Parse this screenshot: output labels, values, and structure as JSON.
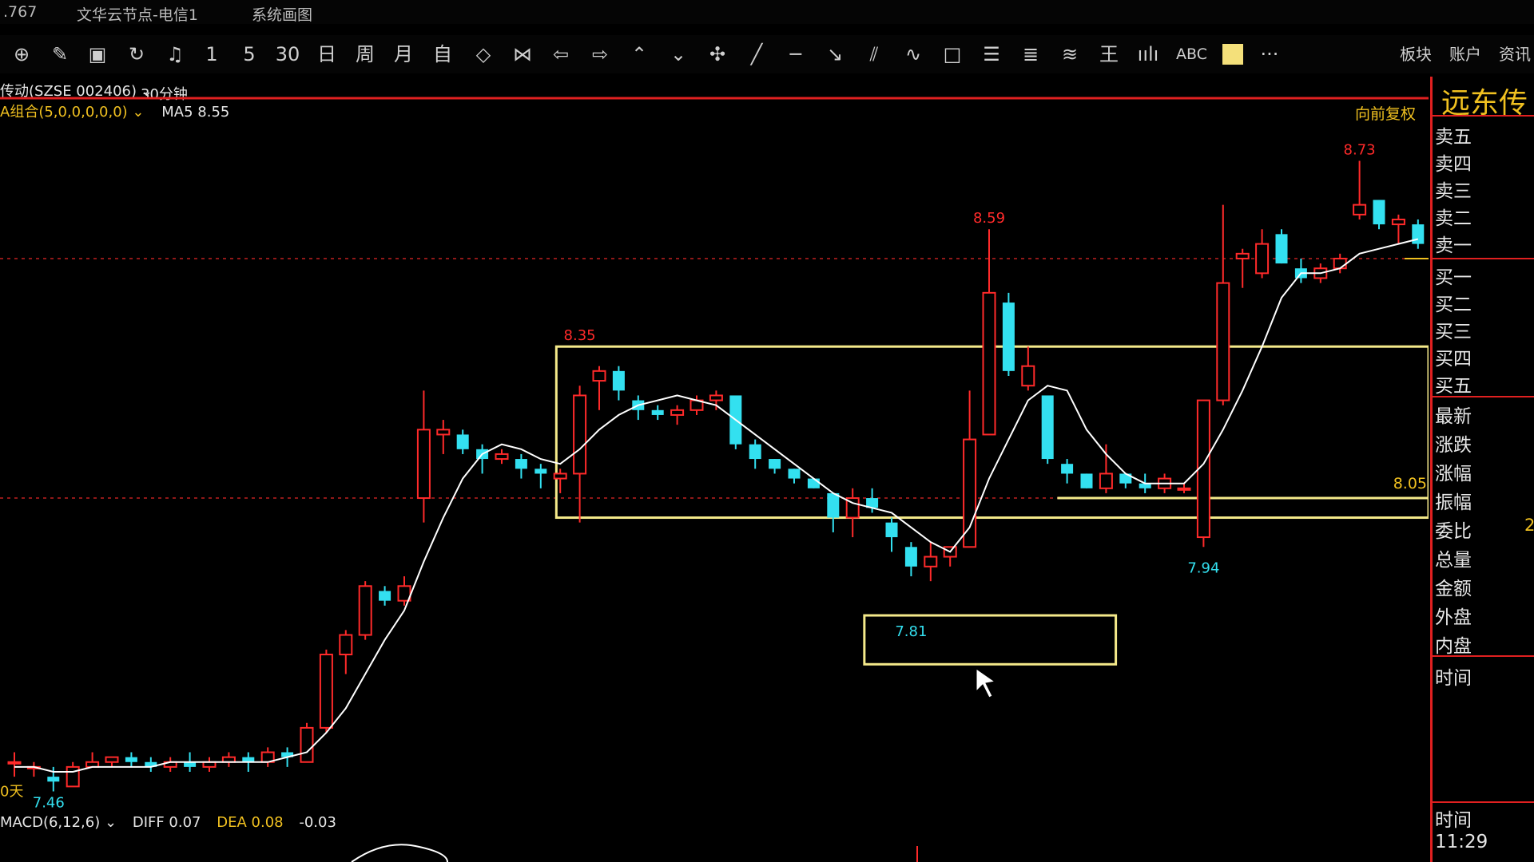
{
  "titlebar": {
    "left_num": ".767",
    "server": "文华云节点-电信1",
    "menu": "系统画图"
  },
  "toolbar": {
    "periods": [
      "1",
      "5",
      "30",
      "日",
      "周",
      "月",
      "自"
    ],
    "text_button": "ABC",
    "more": "···",
    "right_items": [
      "板块",
      "账户",
      "资讯"
    ]
  },
  "chart_header": {
    "stock": "传动(SZSE 002406)",
    "period_select": "30分钟",
    "ma_combo": "A组合(5,0,0,0,0,0)",
    "ma5_label": "MA5",
    "ma5_value": "8.55",
    "adjust": "向前复权"
  },
  "right_panel": {
    "name": "远东传",
    "labels": [
      "卖五",
      "卖四",
      "卖三",
      "卖二",
      "卖一",
      "买一",
      "买二",
      "买三",
      "买四",
      "买五",
      "最新",
      "涨跌",
      "涨幅",
      "振幅",
      "委比",
      "总量",
      "金额",
      "外盘",
      "内盘"
    ],
    "weibi_partial": "2",
    "time_label": "时间",
    "time_label2": "时间",
    "time_value": "11:29"
  },
  "macd": {
    "label": "MACD(6,12,6)",
    "diff": "DIFF 0.07",
    "dea": "DEA 0.08",
    "macd_value": "-0.03"
  },
  "colors": {
    "up": "#ff2a2a",
    "down": "#33e0f0",
    "ma": "#ffffff",
    "box": "#f4e98a",
    "accent": "#f0c020"
  },
  "chart_data": {
    "type": "candlestick",
    "ylim": [
      7.4,
      8.85
    ],
    "candles": [
      {
        "o": 7.5,
        "h": 7.52,
        "l": 7.47,
        "c": 7.5
      },
      {
        "o": 7.49,
        "h": 7.5,
        "l": 7.47,
        "c": 7.49
      },
      {
        "o": 7.47,
        "h": 7.49,
        "l": 7.44,
        "c": 7.46
      },
      {
        "o": 7.45,
        "h": 7.5,
        "l": 7.45,
        "c": 7.49
      },
      {
        "o": 7.49,
        "h": 7.52,
        "l": 7.49,
        "c": 7.5
      },
      {
        "o": 7.5,
        "h": 7.51,
        "l": 7.49,
        "c": 7.51
      },
      {
        "o": 7.51,
        "h": 7.52,
        "l": 7.49,
        "c": 7.5
      },
      {
        "o": 7.5,
        "h": 7.51,
        "l": 7.48,
        "c": 7.49
      },
      {
        "o": 7.49,
        "h": 7.51,
        "l": 7.48,
        "c": 7.5
      },
      {
        "o": 7.5,
        "h": 7.52,
        "l": 7.48,
        "c": 7.49
      },
      {
        "o": 7.49,
        "h": 7.51,
        "l": 7.48,
        "c": 7.5
      },
      {
        "o": 7.5,
        "h": 7.52,
        "l": 7.49,
        "c": 7.51
      },
      {
        "o": 7.51,
        "h": 7.52,
        "l": 7.48,
        "c": 7.5
      },
      {
        "o": 7.5,
        "h": 7.53,
        "l": 7.49,
        "c": 7.52
      },
      {
        "o": 7.52,
        "h": 7.53,
        "l": 7.49,
        "c": 7.51
      },
      {
        "o": 7.5,
        "h": 7.58,
        "l": 7.5,
        "c": 7.57
      },
      {
        "o": 7.57,
        "h": 7.73,
        "l": 7.56,
        "c": 7.72
      },
      {
        "o": 7.72,
        "h": 7.77,
        "l": 7.68,
        "c": 7.76
      },
      {
        "o": 7.76,
        "h": 7.87,
        "l": 7.75,
        "c": 7.86
      },
      {
        "o": 7.85,
        "h": 7.86,
        "l": 7.82,
        "c": 7.83
      },
      {
        "o": 7.83,
        "h": 7.88,
        "l": 7.82,
        "c": 7.86
      },
      {
        "o": 8.04,
        "h": 8.26,
        "l": 7.99,
        "c": 8.18
      },
      {
        "o": 8.17,
        "h": 8.2,
        "l": 8.13,
        "c": 8.18
      },
      {
        "o": 8.17,
        "h": 8.18,
        "l": 8.13,
        "c": 8.14
      },
      {
        "o": 8.14,
        "h": 8.15,
        "l": 8.09,
        "c": 8.12
      },
      {
        "o": 8.12,
        "h": 8.14,
        "l": 8.11,
        "c": 8.13
      },
      {
        "o": 8.12,
        "h": 8.13,
        "l": 8.08,
        "c": 8.1
      },
      {
        "o": 8.1,
        "h": 8.11,
        "l": 8.06,
        "c": 8.09
      },
      {
        "o": 8.08,
        "h": 8.1,
        "l": 8.05,
        "c": 8.09
      },
      {
        "o": 8.09,
        "h": 8.27,
        "l": 7.99,
        "c": 8.25
      },
      {
        "o": 8.28,
        "h": 8.31,
        "l": 8.22,
        "c": 8.3
      },
      {
        "o": 8.3,
        "h": 8.31,
        "l": 8.24,
        "c": 8.26
      },
      {
        "o": 8.24,
        "h": 8.25,
        "l": 8.2,
        "c": 8.22
      },
      {
        "o": 8.22,
        "h": 8.23,
        "l": 8.2,
        "c": 8.21
      },
      {
        "o": 8.21,
        "h": 8.23,
        "l": 8.19,
        "c": 8.22
      },
      {
        "o": 8.22,
        "h": 8.25,
        "l": 8.21,
        "c": 8.24
      },
      {
        "o": 8.24,
        "h": 8.26,
        "l": 8.22,
        "c": 8.25
      },
      {
        "o": 8.25,
        "h": 8.25,
        "l": 8.14,
        "c": 8.15
      },
      {
        "o": 8.15,
        "h": 8.16,
        "l": 8.1,
        "c": 8.12
      },
      {
        "o": 8.12,
        "h": 8.12,
        "l": 8.09,
        "c": 8.1
      },
      {
        "o": 8.1,
        "h": 8.1,
        "l": 8.07,
        "c": 8.08
      },
      {
        "o": 8.08,
        "h": 8.08,
        "l": 8.06,
        "c": 8.06
      },
      {
        "o": 8.05,
        "h": 8.05,
        "l": 7.97,
        "c": 8.0
      },
      {
        "o": 8.0,
        "h": 8.06,
        "l": 7.96,
        "c": 8.04
      },
      {
        "o": 8.04,
        "h": 8.06,
        "l": 8.01,
        "c": 8.02
      },
      {
        "o": 7.99,
        "h": 8.0,
        "l": 7.93,
        "c": 7.96
      },
      {
        "o": 7.94,
        "h": 7.95,
        "l": 7.88,
        "c": 7.9
      },
      {
        "o": 7.9,
        "h": 7.95,
        "l": 7.87,
        "c": 7.92
      },
      {
        "o": 7.92,
        "h": 7.94,
        "l": 7.9,
        "c": 7.94
      },
      {
        "o": 7.94,
        "h": 8.26,
        "l": 7.94,
        "c": 8.16
      },
      {
        "o": 8.17,
        "h": 8.59,
        "l": 8.17,
        "c": 8.46
      },
      {
        "o": 8.44,
        "h": 8.46,
        "l": 8.29,
        "c": 8.3
      },
      {
        "o": 8.27,
        "h": 8.35,
        "l": 8.26,
        "c": 8.31
      },
      {
        "o": 8.25,
        "h": 8.25,
        "l": 8.11,
        "c": 8.12
      },
      {
        "o": 8.11,
        "h": 8.12,
        "l": 8.07,
        "c": 8.09
      },
      {
        "o": 8.09,
        "h": 8.09,
        "l": 8.06,
        "c": 8.06
      },
      {
        "o": 8.06,
        "h": 8.15,
        "l": 8.05,
        "c": 8.09
      },
      {
        "o": 8.09,
        "h": 8.09,
        "l": 8.06,
        "c": 8.07
      },
      {
        "o": 8.07,
        "h": 8.09,
        "l": 8.05,
        "c": 8.06
      },
      {
        "o": 8.06,
        "h": 8.09,
        "l": 8.05,
        "c": 8.08
      },
      {
        "o": 8.06,
        "h": 8.07,
        "l": 8.05,
        "c": 8.06
      },
      {
        "o": 7.96,
        "h": 8.24,
        "l": 7.94,
        "c": 8.24
      },
      {
        "o": 8.24,
        "h": 8.64,
        "l": 8.23,
        "c": 8.48
      },
      {
        "o": 8.53,
        "h": 8.55,
        "l": 8.47,
        "c": 8.54
      },
      {
        "o": 8.5,
        "h": 8.59,
        "l": 8.49,
        "c": 8.56
      },
      {
        "o": 8.58,
        "h": 8.59,
        "l": 8.52,
        "c": 8.52
      },
      {
        "o": 8.51,
        "h": 8.53,
        "l": 8.48,
        "c": 8.49
      },
      {
        "o": 8.49,
        "h": 8.52,
        "l": 8.48,
        "c": 8.51
      },
      {
        "o": 8.51,
        "h": 8.54,
        "l": 8.5,
        "c": 8.53
      },
      {
        "o": 8.62,
        "h": 8.73,
        "l": 8.61,
        "c": 8.64
      },
      {
        "o": 8.65,
        "h": 8.65,
        "l": 8.59,
        "c": 8.6
      },
      {
        "o": 8.6,
        "h": 8.62,
        "l": 8.56,
        "c": 8.61
      },
      {
        "o": 8.6,
        "h": 8.61,
        "l": 8.55,
        "c": 8.56
      }
    ],
    "ma5": [
      7.49,
      7.49,
      7.48,
      7.48,
      7.49,
      7.49,
      7.49,
      7.49,
      7.5,
      7.5,
      7.5,
      7.5,
      7.5,
      7.5,
      7.51,
      7.52,
      7.56,
      7.61,
      7.68,
      7.75,
      7.81,
      7.91,
      8.0,
      8.08,
      8.13,
      8.15,
      8.14,
      8.12,
      8.11,
      8.14,
      8.18,
      8.21,
      8.23,
      8.24,
      8.25,
      8.24,
      8.23,
      8.2,
      8.17,
      8.14,
      8.11,
      8.08,
      8.05,
      8.03,
      8.02,
      8.01,
      7.98,
      7.95,
      7.93,
      7.98,
      8.08,
      8.16,
      8.24,
      8.27,
      8.26,
      8.18,
      8.13,
      8.09,
      8.07,
      8.07,
      8.07,
      8.11,
      8.18,
      8.26,
      8.35,
      8.45,
      8.5,
      8.5,
      8.51,
      8.54,
      8.55,
      8.56,
      8.57
    ],
    "annotations": [
      {
        "text": "8.35",
        "value": 8.35,
        "index": 29
      },
      {
        "text": "8.59",
        "value": 8.59,
        "index": 50
      },
      {
        "text": "8.73",
        "value": 8.73,
        "index": 69
      },
      {
        "text": "7.81",
        "value": 7.81,
        "index": 46
      },
      {
        "text": "7.94",
        "value": 7.94,
        "index": 61
      },
      {
        "text": "7.46",
        "value": 7.46,
        "index": 2
      }
    ],
    "right_axis_label": "8.05",
    "left_fragment": "0天",
    "boxes": [
      {
        "i0": 27.8,
        "i1": 80,
        "v_top": 8.35,
        "v_bottom": 8.0
      },
      {
        "i0": 43.6,
        "i1": 56.5,
        "v_top": 7.8,
        "v_bottom": 7.7
      }
    ],
    "support_line": {
      "i0": 53.5,
      "i1": 80,
      "value": 8.04
    },
    "dashed_lines": [
      8.53,
      8.04
    ]
  }
}
